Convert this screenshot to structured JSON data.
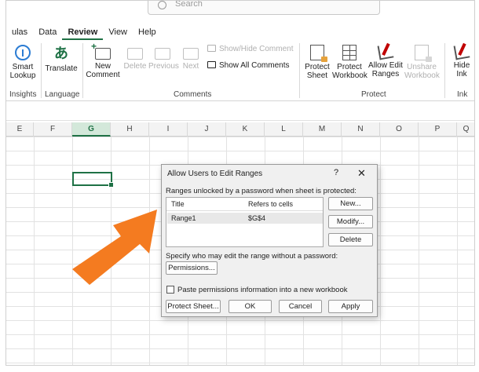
{
  "search": {
    "placeholder": "Search"
  },
  "tabs": [
    "ulas",
    "Data",
    "Review",
    "View",
    "Help"
  ],
  "active_tab": "Review",
  "ribbon": {
    "smart_lookup": "Smart\nLookup",
    "translate": "Translate",
    "new_comment": "New\nComment",
    "delete": "Delete",
    "previous": "Previous",
    "next": "Next",
    "show_hide_comment": "Show/Hide Comment",
    "show_all_comments": "Show All Comments",
    "protect_sheet": "Protect\nSheet",
    "protect_workbook": "Protect\nWorkbook",
    "allow_edit_ranges": "Allow Edit\nRanges",
    "unshare_workbook": "Unshare\nWorkbook",
    "hide_ink": "Hide\nInk",
    "groups": {
      "insights": "Insights",
      "language": "Language",
      "comments": "Comments",
      "protect": "Protect",
      "ink": "Ink"
    }
  },
  "columns": [
    "E",
    "F",
    "G",
    "H",
    "I",
    "J",
    "K",
    "L",
    "M",
    "N",
    "O",
    "P",
    "Q"
  ],
  "selected_column": "G",
  "dialog": {
    "title": "Allow Users to Edit Ranges",
    "help": "?",
    "close": "✕",
    "ranges_label": "Ranges unlocked by a password when sheet is protected:",
    "col_title": "Title",
    "col_refers": "Refers to cells",
    "rows": [
      {
        "title": "Range1",
        "refers": "$G$4"
      }
    ],
    "new_btn": "New...",
    "modify_btn": "Modify...",
    "delete_btn": "Delete",
    "specify_label": "Specify who may edit the range without a password:",
    "permissions_btn": "Permissions...",
    "paste_label": "Paste permissions information into a new workbook",
    "protect_sheet_btn": "Protect Sheet...",
    "ok_btn": "OK",
    "cancel_btn": "Cancel",
    "apply_btn": "Apply"
  },
  "colors": {
    "accent": "#1e7145",
    "arrow": "#f47b20"
  }
}
